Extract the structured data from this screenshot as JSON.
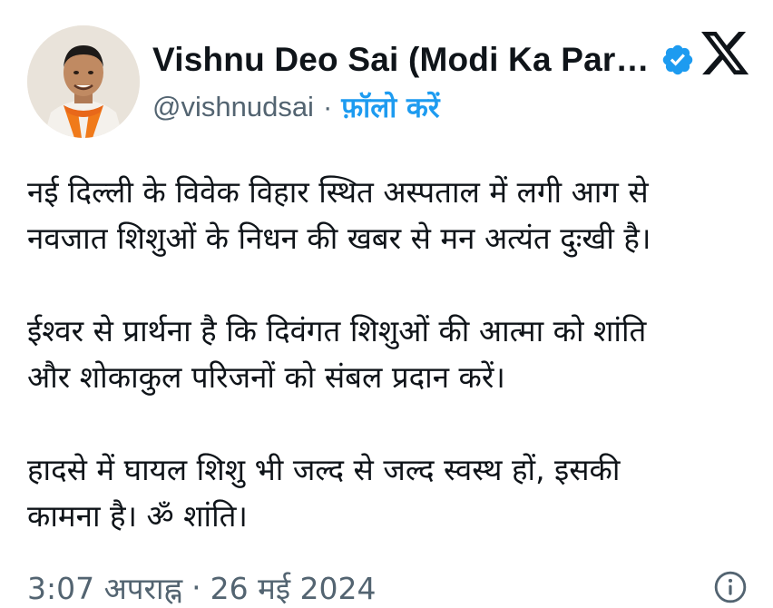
{
  "author": {
    "display_name": "Vishnu Deo Sai (Modi Ka Par…",
    "handle": "@vishnudsai",
    "separator": "·",
    "follow_label": "फ़ॉलो करें",
    "verified_color": "#1d9bf0"
  },
  "icons": {
    "brand": "x-logo-icon",
    "verified": "verified-badge-icon",
    "info": "info-icon"
  },
  "tweet": {
    "paragraphs": [
      [
        "नई दिल्ली के विवेक विहार स्थित अस्पताल में लगी आग से",
        "नवजात शिशुओं के निधन की खबर से मन अत्यंत दुःखी है।"
      ],
      [
        "ईश्वर से प्रार्थना है कि दिवंगत शिशुओं की आत्मा को शांति",
        "और शोकाकुल परिजनों को संबल प्रदान करें।"
      ],
      [
        "हादसे में घायल शिशु भी जल्द से जल्द स्वस्थ हों, इसकी",
        "कामना है। ॐ शांति।"
      ]
    ]
  },
  "meta": {
    "time": "3:07 अपराह्न",
    "separator": "·",
    "date": "26 मई 2024"
  }
}
